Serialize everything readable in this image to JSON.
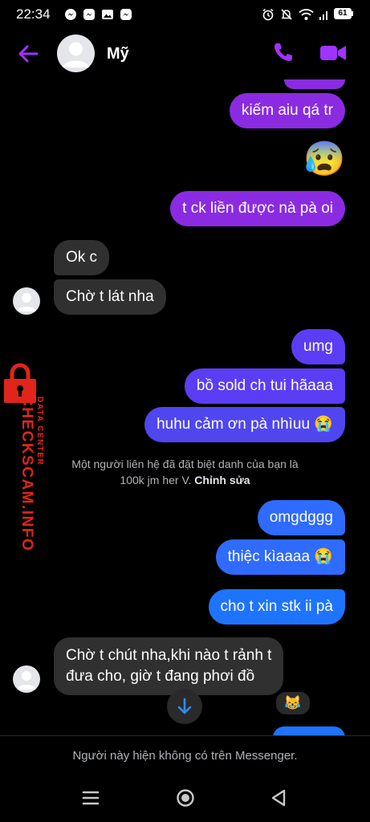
{
  "status_bar": {
    "time": "22:34",
    "battery": "61",
    "icons_left": [
      "messenger-icon",
      "messenger-icon",
      "gallery-icon",
      "messenger-icon"
    ],
    "icons_right": [
      "alarm-icon",
      "mute-icon",
      "wifi-icon",
      "signal-icon",
      "battery-icon"
    ]
  },
  "header": {
    "contact_name": "Mỹ",
    "accent_color": "#a033ff"
  },
  "messages": [
    {
      "side": "out",
      "text": "kiếm aiu qá tr",
      "color": "#8a2be2"
    },
    {
      "side": "out",
      "emoji": "😰"
    },
    {
      "side": "out",
      "text": "t ck liền được nà pà oi",
      "color": "#8a2be2"
    },
    {
      "side": "in",
      "text": "Ok c"
    },
    {
      "side": "in",
      "text": "Chờ t lát nha"
    },
    {
      "side": "out",
      "text": "umg",
      "color": "#5b3df5"
    },
    {
      "side": "out",
      "text": "bồ sold ch tui hãaaa",
      "color": "#5b3df5"
    },
    {
      "side": "out",
      "text": "huhu cảm ơn pà nhìuu 😭",
      "color": "#4f46f0"
    },
    {
      "side": "out",
      "text": "omgdggg",
      "color": "#2f6bff"
    },
    {
      "side": "out",
      "text": "thiệc kìaaaa 😭",
      "color": "#2f6bff"
    },
    {
      "side": "out",
      "text": "cho t xin stk ii pà",
      "color": "#1e74ff"
    },
    {
      "side": "in",
      "text_line1": "Chờ t chút nha,khi nào t rảnh t",
      "text_line2": "đưa cho, giờ t đang phơi đồ",
      "reaction": "😹"
    }
  ],
  "system_notice": {
    "text_line1": "Một người liên hệ đã đặt biệt danh của bạn là",
    "text_line2": "100k jm her V.",
    "action": "Chỉnh sửa"
  },
  "watermark": {
    "line1": "DATA CENTER",
    "line2": "CHECKSCAM.INFO",
    "color": "#e0251b"
  },
  "footer": {
    "notice": "Người này hiện không có trên Messenger."
  }
}
